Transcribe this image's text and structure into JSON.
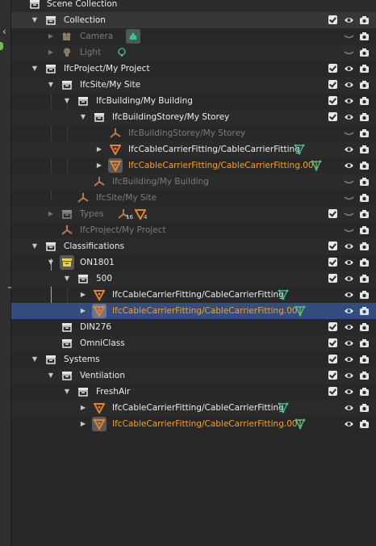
{
  "outliner": {
    "rows": [
      {
        "label": "Scene Collection"
      },
      {
        "label": "Collection"
      },
      {
        "label": "Camera"
      },
      {
        "label": "Light"
      },
      {
        "label": "IfcProject/My Project"
      },
      {
        "label": "IfcSite/My Site"
      },
      {
        "label": "IfcBuilding/My Building"
      },
      {
        "label": "IfcBuildingStorey/My Storey"
      },
      {
        "label": "IfcBuildingStorey/My Storey"
      },
      {
        "label": "IfcCableCarrierFitting/CableCarrierFitting"
      },
      {
        "label": "IfcCableCarrierFitting/CableCarrierFitting.001"
      },
      {
        "label": "IfcBuilding/My Building"
      },
      {
        "label": "IfcSite/My Site"
      },
      {
        "label": "Types",
        "count_a": "16",
        "count_b": "4"
      },
      {
        "label": "IfcProject/My Project"
      },
      {
        "label": "Classifications"
      },
      {
        "label": "ON1801"
      },
      {
        "label": "500"
      },
      {
        "label": "IfcCableCarrierFitting/CableCarrierFitting"
      },
      {
        "label": "IfcCableCarrierFitting/CableCarrierFitting.001"
      },
      {
        "label": "DIN276"
      },
      {
        "label": "OmniClass"
      },
      {
        "label": "Systems"
      },
      {
        "label": "Ventilation"
      },
      {
        "label": "FreshAir"
      },
      {
        "label": "IfcCableCarrierFitting/CableCarrierFitting"
      },
      {
        "label": "IfcCableCarrierFitting/CableCarrierFitting.001"
      }
    ]
  },
  "colors": {
    "selection": "#334d80",
    "active_label": "#f0a030",
    "mesh_icon": "#e8832a",
    "data_icon": "#3ec38a",
    "collection_icon": "#e6e6e6",
    "classification_icon": "#e8d33a"
  },
  "icons": {
    "expand": "triangle-down-icon",
    "collapse": "triangle-right-icon",
    "collection": "collection-box-icon",
    "object": "mesh-triangle-icon",
    "empty": "empty-axes-icon",
    "visibility": "eye-icon",
    "render": "camera-icon",
    "checkbox": "checkbox-checked-icon"
  }
}
